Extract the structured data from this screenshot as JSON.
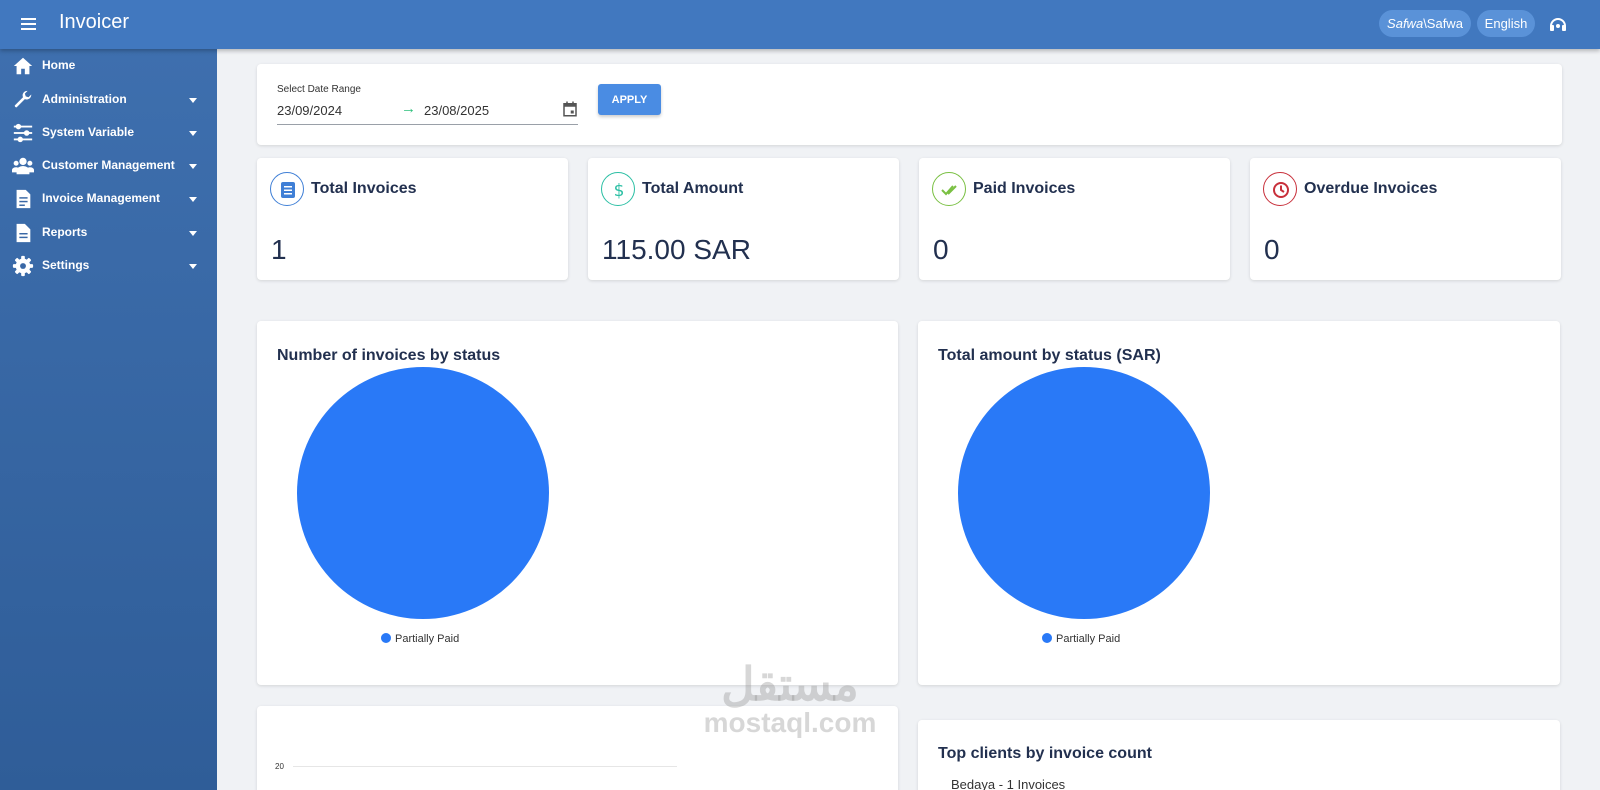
{
  "app": {
    "title": "Invoicer"
  },
  "header": {
    "user_italic": "Safwa",
    "user_rest": "\\Safwa",
    "language": "English"
  },
  "sidebar": {
    "items": [
      {
        "label": "Home",
        "icon": "home-icon",
        "expandable": false
      },
      {
        "label": "Administration",
        "icon": "wrench-icon",
        "expandable": true
      },
      {
        "label": "System Variable",
        "icon": "sliders-icon",
        "expandable": true
      },
      {
        "label": "Customer Management",
        "icon": "users-icon",
        "expandable": true
      },
      {
        "label": "Invoice Management",
        "icon": "invoice-file-icon",
        "expandable": true
      },
      {
        "label": "Reports",
        "icon": "report-file-icon",
        "expandable": true
      },
      {
        "label": "Settings",
        "icon": "gear-icon",
        "expandable": true
      }
    ]
  },
  "filter": {
    "label": "Select Date Range",
    "from": "23/09/2024",
    "arrow": "→",
    "to": "23/08/2025",
    "apply_label": "APPLY"
  },
  "stats": [
    {
      "title": "Total Invoices",
      "value": "1",
      "icon": "list-icon",
      "color": "#3f7fd6"
    },
    {
      "title": "Total Amount",
      "value": "115.00 SAR",
      "icon": "dollar-icon",
      "color": "#2bbfa4"
    },
    {
      "title": "Paid Invoices",
      "value": "0",
      "icon": "double-check-icon",
      "color": "#7ac043"
    },
    {
      "title": "Overdue Invoices",
      "value": "0",
      "icon": "clock-icon",
      "color": "#c8303b"
    }
  ],
  "charts": {
    "status_count": {
      "title": "Number of invoices by status",
      "legend": "Partially Paid"
    },
    "status_amount": {
      "title": "Total amount by status (SAR)",
      "legend": "Partially Paid"
    },
    "bar_partial": {
      "tick": "20"
    }
  },
  "chart_data": [
    {
      "type": "pie",
      "title": "Number of invoices by status",
      "categories": [
        "Partially Paid"
      ],
      "values": [
        1
      ],
      "colors": [
        "#2979f7"
      ],
      "legend": "bottom"
    },
    {
      "type": "pie",
      "title": "Total amount by status (SAR)",
      "categories": [
        "Partially Paid"
      ],
      "values": [
        115.0
      ],
      "colors": [
        "#2979f7"
      ],
      "legend": "bottom"
    }
  ],
  "top_clients": {
    "title": "Top clients by invoice count",
    "items": [
      "Bedaya - 1 Invoices"
    ]
  },
  "watermark": {
    "arabic": "مستقل",
    "latin": "mostaql.com"
  },
  "colors": {
    "header": "#4178bf",
    "sidebar": "#3a68a6",
    "accent": "#4a8ce3",
    "pie": "#2979f7"
  }
}
